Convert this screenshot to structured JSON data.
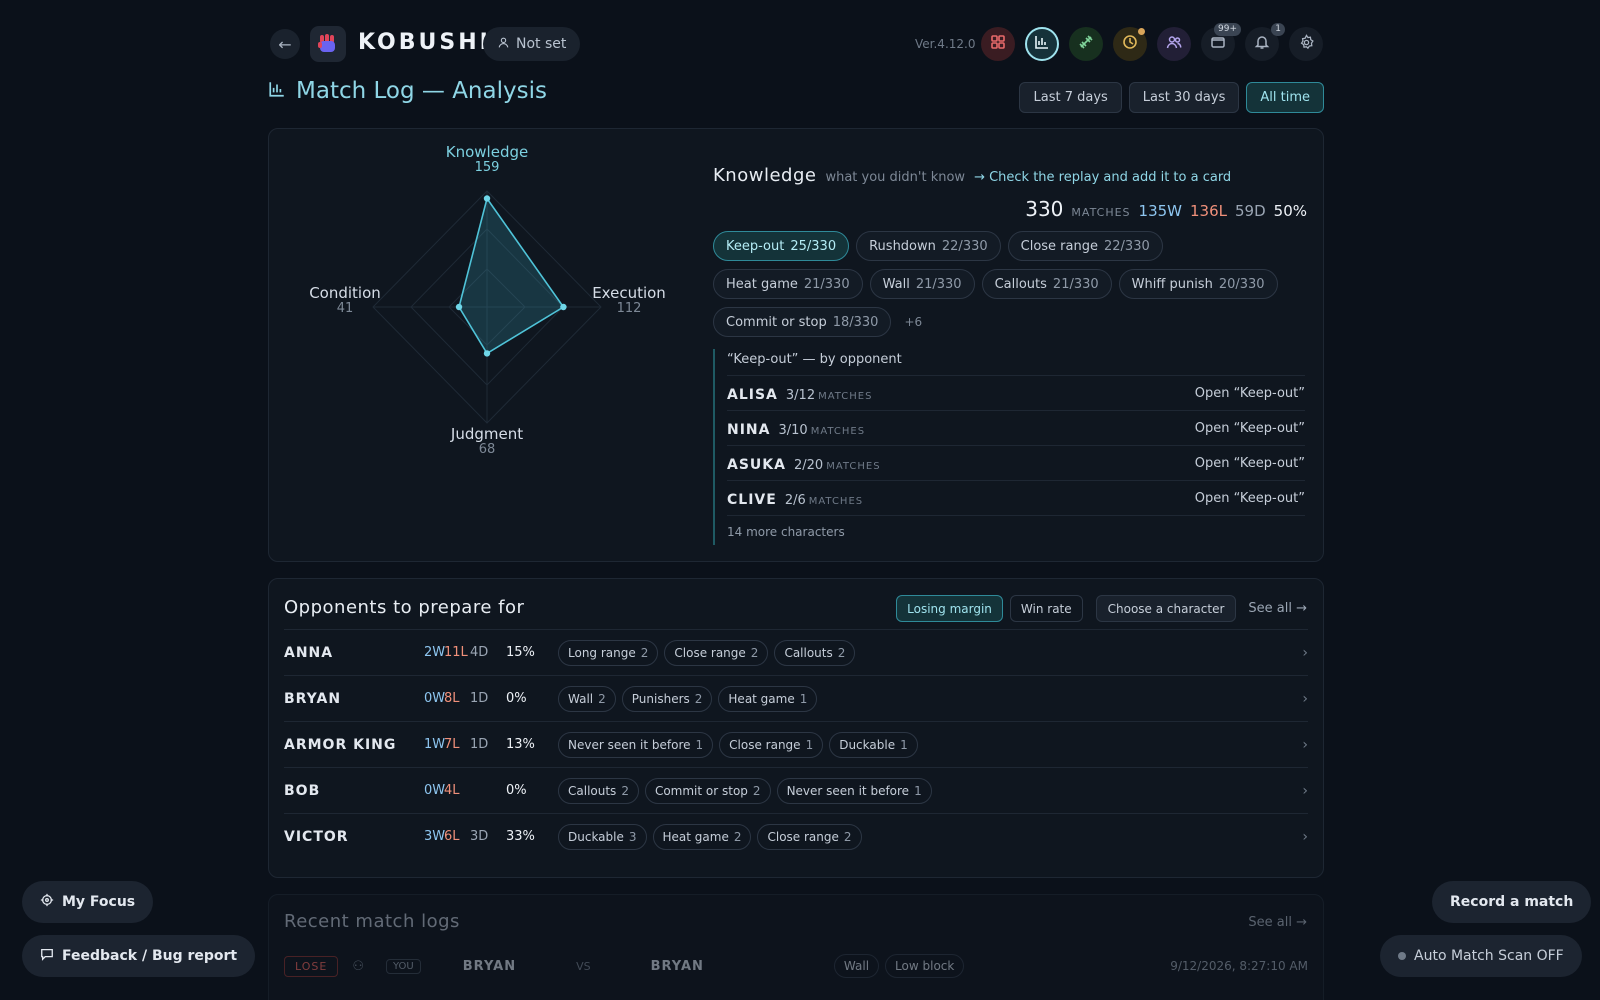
{
  "header": {
    "brand": "KOBUSHI",
    "profile_label": "Not set",
    "version": "Ver.4.12.0",
    "storage_badge": "99+",
    "notif_badge": "1"
  },
  "page": {
    "title": "Match Log — Analysis"
  },
  "ranges": [
    "Last 7 days",
    "Last 30 days",
    "All time"
  ],
  "active_range": "All time",
  "radar": {
    "axes": [
      {
        "label": "Knowledge",
        "value": 159
      },
      {
        "label": "Execution",
        "value": 112
      },
      {
        "label": "Judgment",
        "value": 68
      },
      {
        "label": "Condition",
        "value": 41
      }
    ]
  },
  "knowledge": {
    "title": "Knowledge",
    "subtitle": "what you didn't know",
    "cta": "→ Check the replay and add it to a card",
    "total": "330",
    "matches_label": "MATCHES",
    "wins": "135W",
    "losses": "136L",
    "draws": "59D",
    "rate": "50%",
    "chips": [
      {
        "label": "Keep-out",
        "count": "25/330"
      },
      {
        "label": "Rushdown",
        "count": "22/330"
      },
      {
        "label": "Close range",
        "count": "22/330"
      },
      {
        "label": "Heat game",
        "count": "21/330"
      },
      {
        "label": "Wall",
        "count": "21/330"
      },
      {
        "label": "Callouts",
        "count": "21/330"
      },
      {
        "label": "Whiff punish",
        "count": "20/330"
      },
      {
        "label": "Commit or stop",
        "count": "18/330"
      }
    ],
    "more": "+6",
    "by_opponent_title": "“Keep-out” — by opponent",
    "by_opponent": [
      {
        "name": "ALISA",
        "count": "3/12",
        "unit": "MATCHES",
        "link": "Open “Keep-out”"
      },
      {
        "name": "NINA",
        "count": "3/10",
        "unit": "MATCHES",
        "link": "Open “Keep-out”"
      },
      {
        "name": "ASUKA",
        "count": "2/20",
        "unit": "MATCHES",
        "link": "Open “Keep-out”"
      },
      {
        "name": "CLIVE",
        "count": "2/6",
        "unit": "MATCHES",
        "link": "Open “Keep-out”"
      }
    ],
    "more_characters": "14 more characters"
  },
  "opponents": {
    "title": "Opponents to prepare for",
    "sort_options": [
      "Losing margin",
      "Win rate"
    ],
    "choose_label": "Choose a character",
    "see_all": "See all →",
    "rows": [
      {
        "name": "ANNA",
        "w": "2W",
        "l": "11L",
        "d": "4D",
        "rate": "15%",
        "tags": [
          {
            "label": "Long range",
            "n": "2"
          },
          {
            "label": "Close range",
            "n": "2"
          },
          {
            "label": "Callouts",
            "n": "2"
          }
        ]
      },
      {
        "name": "BRYAN",
        "w": "0W",
        "l": "8L",
        "d": "1D",
        "rate": "0%",
        "tags": [
          {
            "label": "Wall",
            "n": "2"
          },
          {
            "label": "Punishers",
            "n": "2"
          },
          {
            "label": "Heat game",
            "n": "1"
          }
        ]
      },
      {
        "name": "ARMOR KING",
        "w": "1W",
        "l": "7L",
        "d": "1D",
        "rate": "13%",
        "tags": [
          {
            "label": "Never seen it before",
            "n": "1"
          },
          {
            "label": "Close range",
            "n": "1"
          },
          {
            "label": "Duckable",
            "n": "1"
          }
        ]
      },
      {
        "name": "BOB",
        "w": "0W",
        "l": "4L",
        "d": "",
        "rate": "0%",
        "tags": [
          {
            "label": "Callouts",
            "n": "2"
          },
          {
            "label": "Commit or stop",
            "n": "2"
          },
          {
            "label": "Never seen it before",
            "n": "1"
          }
        ]
      },
      {
        "name": "VICTOR",
        "w": "3W",
        "l": "6L",
        "d": "3D",
        "rate": "33%",
        "tags": [
          {
            "label": "Duckable",
            "n": "3"
          },
          {
            "label": "Heat game",
            "n": "2"
          },
          {
            "label": "Close range",
            "n": "2"
          }
        ]
      }
    ]
  },
  "recent": {
    "title": "Recent match logs",
    "see_all": "See all →",
    "row": {
      "result": "LOSE",
      "side": "YOU",
      "p1": "BRYAN",
      "vs": "VS",
      "p2": "BRYAN",
      "tags": [
        "Wall",
        "Low block"
      ],
      "time": "9/12/2026, 8:27:10 AM"
    }
  },
  "floating": {
    "focus": "My Focus",
    "feedback": "Feedback / Bug report",
    "record": "Record a match",
    "autoscan": "Auto Match Scan OFF"
  }
}
